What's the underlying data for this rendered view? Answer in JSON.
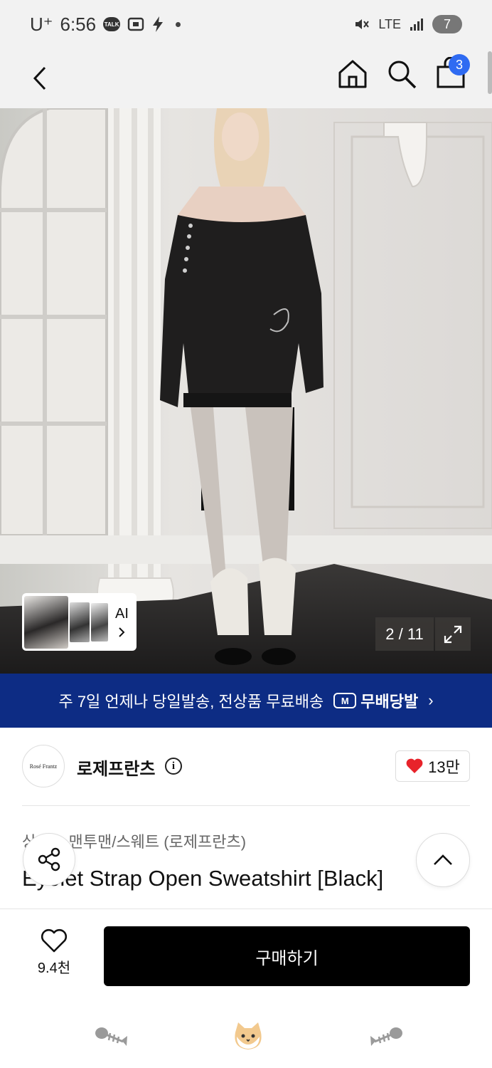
{
  "status_bar": {
    "carrier": "U⁺",
    "time": "6:56",
    "talk_badge": "TALK",
    "network": "LTE",
    "battery": "7"
  },
  "header": {
    "cart_count": "3"
  },
  "gallery": {
    "ai_label": "AI",
    "counter": "2 / 11"
  },
  "promo": {
    "text": "주 7일 언제나 당일발송, 전상품 무료배송",
    "badge": "M",
    "brand": "무배당발",
    "arrow": "›"
  },
  "store": {
    "logo_text": "Rosé Frantz",
    "name": "로제프란츠",
    "info": "i",
    "likes": "13만"
  },
  "product": {
    "category": "상의 > 맨투맨/스웨트 (로제프란츠)",
    "title": "Eyelet Strap Open Sweatshirt [Black]"
  },
  "bottom": {
    "wish_count": "9.4천",
    "buy_label": "구매하기"
  },
  "colors": {
    "promo_bg": "#0d2c84",
    "badge_blue": "#2f6bf2",
    "heart_red": "#e8232a",
    "buy_bg": "#000000"
  },
  "icons": [
    "back-icon",
    "home-icon",
    "search-icon",
    "bag-icon",
    "expand-icon",
    "info-icon",
    "heart-icon",
    "share-icon",
    "chevron-up-icon",
    "fish-bone-icon",
    "cat-icon"
  ]
}
